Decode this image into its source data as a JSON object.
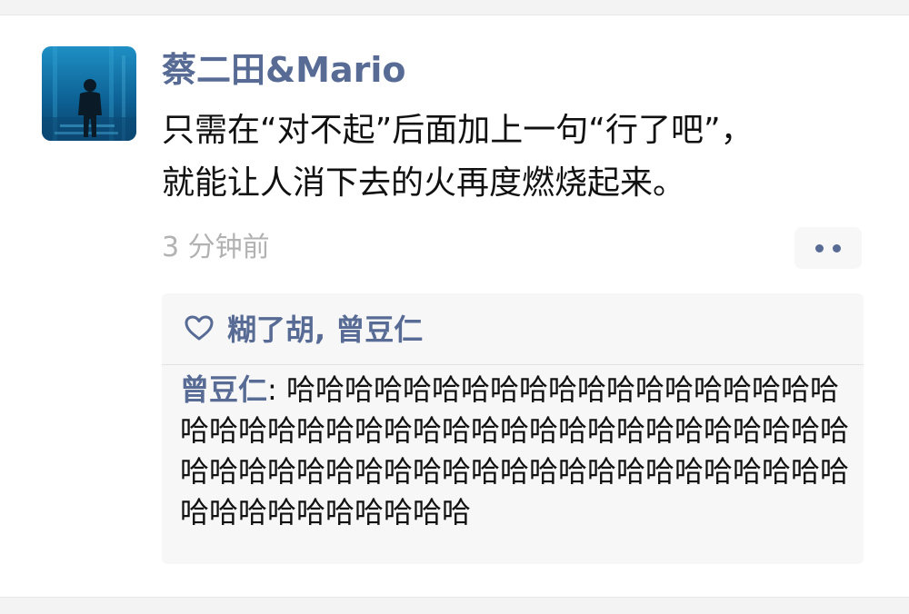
{
  "post": {
    "username": "蔡二田&Mario",
    "text_lines": [
      "只需在“对不起”后面加上一句“行了吧”，",
      "就能让人消下去的火再度燃烧起来。"
    ],
    "timestamp": "3 分钟前",
    "avatar_icon": "person-silhouette-aquarium-avatar",
    "more_icon": "two-dots-icon"
  },
  "likes": {
    "icon": "heart-outline-icon",
    "names": "糊了胡, 曾豆仁"
  },
  "comments": [
    {
      "author": "曾豆仁",
      "separator": ": ",
      "text": "哈哈哈哈哈哈哈哈哈哈哈哈哈哈哈哈哈哈哈哈哈哈哈哈哈哈哈哈哈哈哈哈哈哈哈哈哈哈哈哈哈哈哈哈哈哈哈哈哈哈哈哈哈哈哈哈哈哈哈哈哈哈哈哈哈哈哈哈哈哈哈哈哈哈哈"
    }
  ],
  "colors": {
    "link_blue": "#576b95",
    "text": "#111111",
    "muted": "#b2b2b2",
    "comment_bg": "#f7f7f7"
  }
}
